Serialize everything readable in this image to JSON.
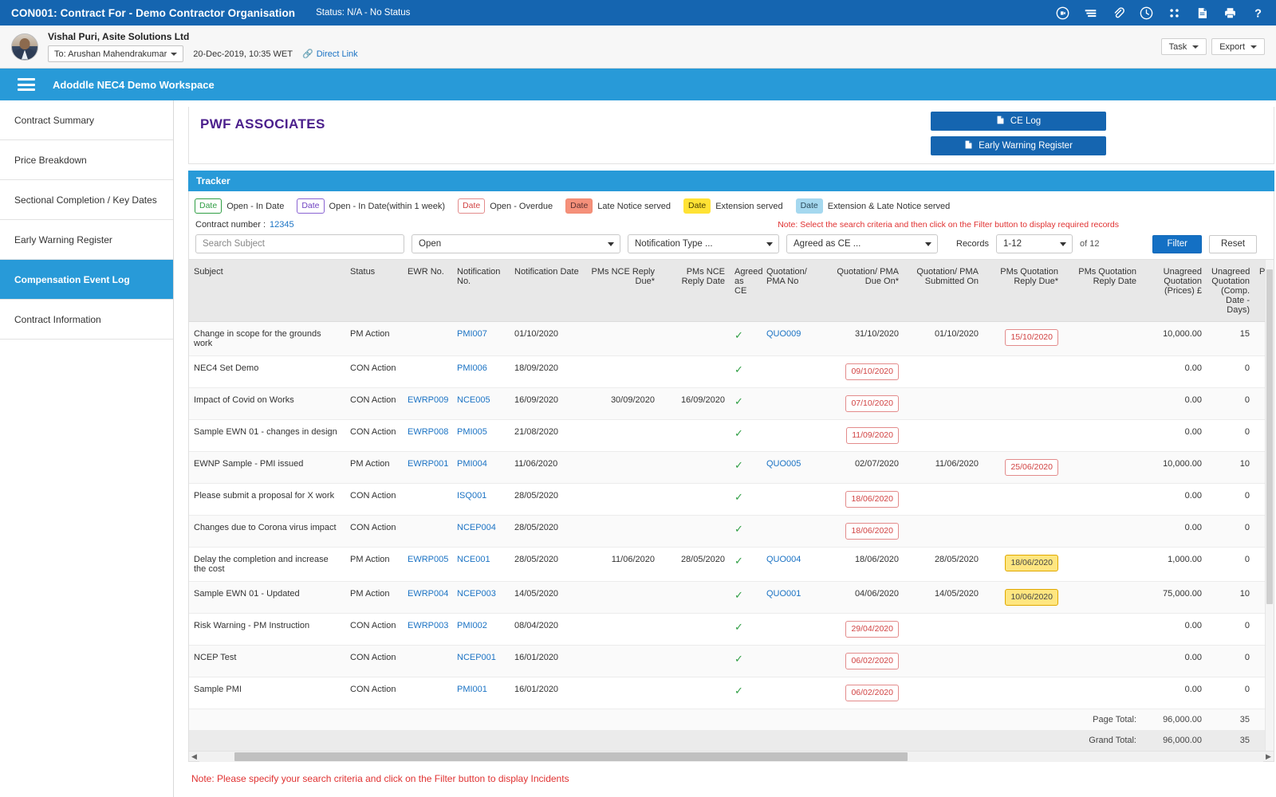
{
  "topbar": {
    "title": "CON001: Contract For - Demo Contractor Organisation",
    "status": "Status: N/A - No Status",
    "icons": [
      "video-icon",
      "list-lines-icon",
      "paperclip-icon",
      "clock-icon",
      "grid-apps-icon",
      "document-icon",
      "printer-icon",
      "help-icon"
    ]
  },
  "userbar": {
    "name": "Vishal Puri, Asite Solutions Ltd",
    "to_label": "To: Arushan Mahendrakumar",
    "timestamp": "20-Dec-2019, 10:35 WET",
    "direct_link": "Direct Link",
    "task_label": "Task",
    "export_label": "Export"
  },
  "workspace": {
    "title": "Adoddle NEC4 Demo Workspace"
  },
  "sidebar": {
    "items": [
      {
        "label": "Contract Summary",
        "active": false
      },
      {
        "label": "Price Breakdown",
        "active": false
      },
      {
        "label": "Sectional Completion / Key Dates",
        "active": false
      },
      {
        "label": "Early Warning Register",
        "active": false
      },
      {
        "label": "Compensation Event Log",
        "active": true
      },
      {
        "label": "Contract Information",
        "active": false
      }
    ]
  },
  "brand": {
    "name": "PWF ASSOCIATES",
    "ce_log_label": "CE Log",
    "ewr_label": "Early Warning Register"
  },
  "tracker": {
    "title": "Tracker",
    "legend": [
      {
        "chip": "Date",
        "label": "Open - In Date",
        "text_color": "#2f9e44",
        "border_color": "#2f9e44",
        "bg": "#ffffff"
      },
      {
        "chip": "Date",
        "label": "Open - In Date(within 1 week)",
        "text_color": "#6f42c1",
        "border_color": "#8a63d2",
        "bg": "#ffffff"
      },
      {
        "chip": "Date",
        "label": "Open - Overdue",
        "text_color": "#d14343",
        "border_color": "#e38b8b",
        "bg": "#ffffff"
      },
      {
        "chip": "Date",
        "label": "Late Notice served",
        "text_color": "#5a3030",
        "border_color": "#f08a72",
        "bg": "#f5907a"
      },
      {
        "chip": "Date",
        "label": "Extension served",
        "text_color": "#4a4000",
        "border_color": "#ffe234",
        "bg": "#ffe234"
      },
      {
        "chip": "Date",
        "label": "Extension & Late Notice served",
        "text_color": "#2b4a5a",
        "border_color": "#a5d8ef",
        "bg": "#a5d8ef"
      }
    ],
    "contract_number_label": "Contract number :",
    "contract_number": "12345",
    "filter_note": "Note: Select the search criteria and then click on the Filter button to display required records",
    "search_placeholder": "Search Subject",
    "status_filter": "Open",
    "notification_type_filter": "Notification Type ...",
    "agreed_filter": "Agreed as CE ...",
    "records_label": "Records",
    "records_range": "1-12",
    "records_of": "of 12",
    "filter_button": "Filter",
    "reset_button": "Reset"
  },
  "table": {
    "columns": [
      "Subject",
      "Status",
      "EWR No.",
      "Notification No.",
      "Notification Date",
      "PMs NCE Reply Due*",
      "PMs NCE Reply Date",
      "Agreed as CE",
      "Quotation/ PMA No",
      "Quotation/ PMA Due On*",
      "Quotation/ PMA Submitted On",
      "PMs Quotation Reply Due*",
      "PMs Quotation Reply Date",
      "Unagreed Quotation (Prices) £",
      "Unagreed Quotation (Comp. Date - Days)",
      "P"
    ],
    "rows": [
      {
        "subject": "Change in scope for the grounds work",
        "status": "PM Action",
        "ewr": "",
        "notif_no": "PMI007",
        "notif_date": "01/10/2020",
        "nce_due": "",
        "nce_date": "",
        "agreed": true,
        "quo_no": "QUO009",
        "quo_due": "31/10/2020",
        "quo_sub": "01/10/2020",
        "pm_quo_due": "15/10/2020",
        "pm_quo_due_style": "red",
        "pm_quo_date": "",
        "unagreed_price": "10,000.00",
        "unagreed_days": "15"
      },
      {
        "subject": "NEC4 Set Demo",
        "status": "CON Action",
        "ewr": "",
        "notif_no": "PMI006",
        "notif_date": "18/09/2020",
        "nce_due": "",
        "nce_date": "",
        "agreed": true,
        "quo_no": "",
        "quo_due": "09/10/2020",
        "quo_due_style": "red",
        "quo_sub": "",
        "pm_quo_due": "",
        "pm_quo_date": "",
        "unagreed_price": "0.00",
        "unagreed_days": "0"
      },
      {
        "subject": "Impact of Covid on Works",
        "status": "CON Action",
        "ewr": "EWRP009",
        "notif_no": "NCE005",
        "notif_date": "16/09/2020",
        "nce_due": "30/09/2020",
        "nce_date": "16/09/2020",
        "agreed": true,
        "quo_no": "",
        "quo_due": "07/10/2020",
        "quo_due_style": "red",
        "quo_sub": "",
        "pm_quo_due": "",
        "pm_quo_date": "",
        "unagreed_price": "0.00",
        "unagreed_days": "0"
      },
      {
        "subject": "Sample EWN 01 - changes in design",
        "status": "CON Action",
        "ewr": "EWRP008",
        "notif_no": "PMI005",
        "notif_date": "21/08/2020",
        "nce_due": "",
        "nce_date": "",
        "agreed": true,
        "quo_no": "",
        "quo_due": "11/09/2020",
        "quo_due_style": "red",
        "quo_sub": "",
        "pm_quo_due": "",
        "pm_quo_date": "",
        "unagreed_price": "0.00",
        "unagreed_days": "0"
      },
      {
        "subject": "EWNP Sample - PMI issued",
        "status": "PM Action",
        "ewr": "EWRP001",
        "notif_no": "PMI004",
        "notif_date": "11/06/2020",
        "nce_due": "",
        "nce_date": "",
        "agreed": true,
        "quo_no": "QUO005",
        "quo_due": "02/07/2020",
        "quo_sub": "11/06/2020",
        "pm_quo_due": "25/06/2020",
        "pm_quo_due_style": "red",
        "pm_quo_date": "",
        "unagreed_price": "10,000.00",
        "unagreed_days": "10"
      },
      {
        "subject": "Please submit a proposal for X work",
        "status": "CON Action",
        "ewr": "",
        "notif_no": "ISQ001",
        "notif_date": "28/05/2020",
        "nce_due": "",
        "nce_date": "",
        "agreed": true,
        "quo_no": "",
        "quo_due": "18/06/2020",
        "quo_due_style": "red",
        "quo_sub": "",
        "pm_quo_due": "",
        "pm_quo_date": "",
        "unagreed_price": "0.00",
        "unagreed_days": "0"
      },
      {
        "subject": "Changes due to Corona virus impact",
        "status": "CON Action",
        "ewr": "",
        "notif_no": "NCEP004",
        "notif_date": "28/05/2020",
        "nce_due": "",
        "nce_date": "",
        "agreed": true,
        "quo_no": "",
        "quo_due": "18/06/2020",
        "quo_due_style": "red",
        "quo_sub": "",
        "pm_quo_due": "",
        "pm_quo_date": "",
        "unagreed_price": "0.00",
        "unagreed_days": "0"
      },
      {
        "subject": "Delay the completion and increase the cost",
        "status": "PM Action",
        "ewr": "EWRP005",
        "notif_no": "NCE001",
        "notif_date": "28/05/2020",
        "nce_due": "11/06/2020",
        "nce_date": "28/05/2020",
        "agreed": true,
        "quo_no": "QUO004",
        "quo_due": "18/06/2020",
        "quo_sub": "28/05/2020",
        "pm_quo_due": "18/06/2020",
        "pm_quo_due_style": "yellow",
        "pm_quo_date": "",
        "unagreed_price": "1,000.00",
        "unagreed_days": "0"
      },
      {
        "subject": "Sample EWN 01 - Updated",
        "status": "PM Action",
        "ewr": "EWRP004",
        "notif_no": "NCEP003",
        "notif_date": "14/05/2020",
        "nce_due": "",
        "nce_date": "",
        "agreed": true,
        "quo_no": "QUO001",
        "quo_due": "04/06/2020",
        "quo_sub": "14/05/2020",
        "pm_quo_due": "10/06/2020",
        "pm_quo_due_style": "yellow",
        "pm_quo_date": "",
        "unagreed_price": "75,000.00",
        "unagreed_days": "10"
      },
      {
        "subject": "Risk Warning - PM Instruction",
        "status": "CON Action",
        "ewr": "EWRP003",
        "notif_no": "PMI002",
        "notif_date": "08/04/2020",
        "nce_due": "",
        "nce_date": "",
        "agreed": true,
        "quo_no": "",
        "quo_due": "29/04/2020",
        "quo_due_style": "red",
        "quo_sub": "",
        "pm_quo_due": "",
        "pm_quo_date": "",
        "unagreed_price": "0.00",
        "unagreed_days": "0"
      },
      {
        "subject": "NCEP Test",
        "status": "CON Action",
        "ewr": "",
        "notif_no": "NCEP001",
        "notif_date": "16/01/2020",
        "nce_due": "",
        "nce_date": "",
        "agreed": true,
        "quo_no": "",
        "quo_due": "06/02/2020",
        "quo_due_style": "red",
        "quo_sub": "",
        "pm_quo_due": "",
        "pm_quo_date": "",
        "unagreed_price": "0.00",
        "unagreed_days": "0"
      },
      {
        "subject": "Sample PMI",
        "status": "CON Action",
        "ewr": "",
        "notif_no": "PMI001",
        "notif_date": "16/01/2020",
        "nce_due": "",
        "nce_date": "",
        "agreed": true,
        "quo_no": "",
        "quo_due": "06/02/2020",
        "quo_due_style": "red",
        "quo_sub": "",
        "pm_quo_due": "",
        "pm_quo_date": "",
        "unagreed_price": "0.00",
        "unagreed_days": "0"
      }
    ],
    "page_total_label": "Page Total:",
    "page_total_price": "96,000.00",
    "page_total_days": "35",
    "grand_total_label": "Grand Total:",
    "grand_total_price": "96,000.00",
    "grand_total_days": "35"
  },
  "bottom_note": "Note: Please specify your search criteria and click on the Filter button to display Incidents"
}
